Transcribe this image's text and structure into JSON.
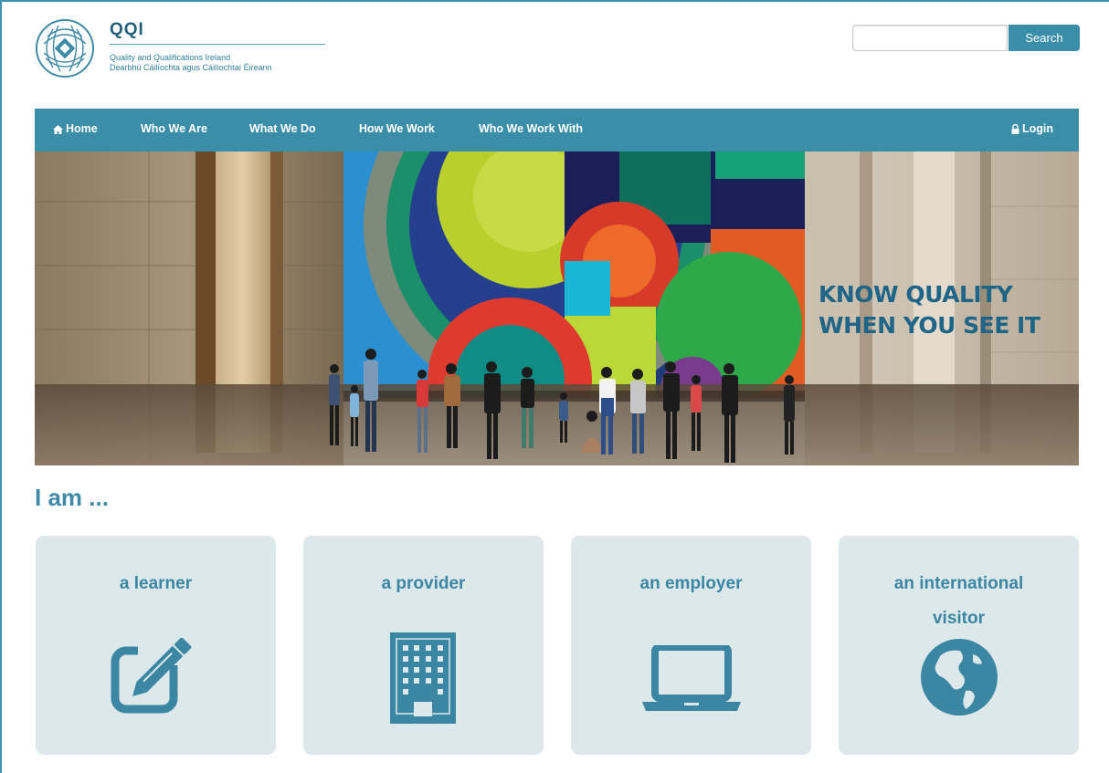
{
  "header": {
    "brand_name": "QQI",
    "brand_line1": "Quality and Qualifications Ireland",
    "brand_line2": "Dearbhú Cáilíochta agus Cáilíochtaí Éireann",
    "search_placeholder": "",
    "search_button": "Search"
  },
  "nav": {
    "items": [
      {
        "label": "Home",
        "icon": "home-icon"
      },
      {
        "label": "Who We Are"
      },
      {
        "label": "What We Do"
      },
      {
        "label": "How We Work"
      },
      {
        "label": "Who We Work With"
      }
    ],
    "login": {
      "label": "Login",
      "icon": "lock-icon"
    }
  },
  "hero": {
    "line1": "KNOW QUALITY",
    "line2": "WHEN YOU SEE IT"
  },
  "audience": {
    "heading": "I am ...",
    "cards": [
      {
        "title": "a learner",
        "icon": "edit-icon"
      },
      {
        "title": "a provider",
        "icon": "building-icon"
      },
      {
        "title": "an employer",
        "icon": "laptop-icon"
      },
      {
        "title_line1": "an international",
        "title_line2": "visitor",
        "icon": "globe-icon"
      }
    ]
  },
  "colors": {
    "accent": "#3b8ea8",
    "brand_dark": "#1f6587",
    "card_bg": "#dde8eb",
    "card_text": "#3b86a3"
  }
}
